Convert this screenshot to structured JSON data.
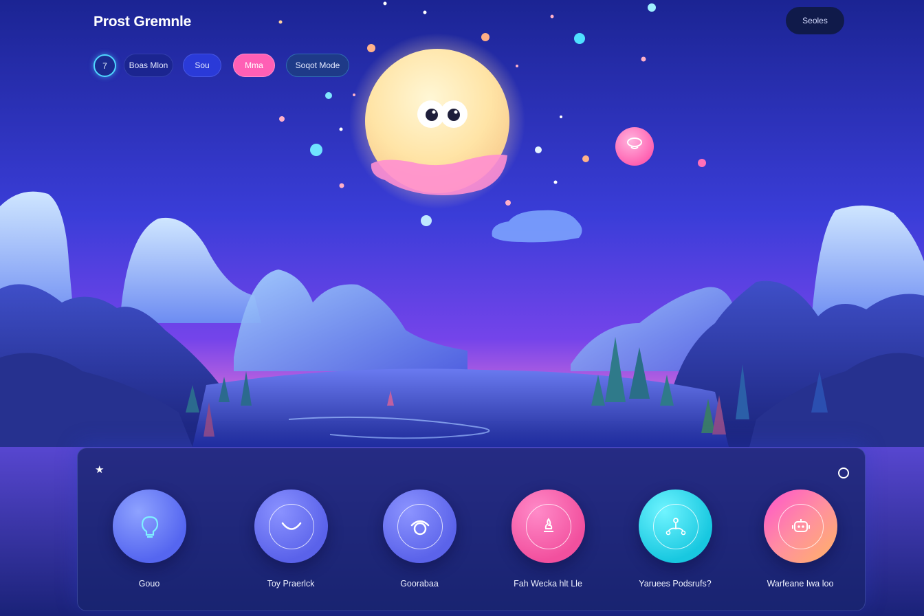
{
  "app": {
    "title": "Prost Gremnle",
    "top_button_label": "Seoles"
  },
  "nav": {
    "level": "7",
    "pills": [
      "Boas Mlon",
      "Sou",
      "Mma",
      "Soqot Mode"
    ]
  },
  "panel": {
    "items": [
      {
        "label": "Gouo",
        "icon": "lightbulb-icon",
        "color": "#5e6ff2"
      },
      {
        "label": "Toy Praerlck",
        "icon": "smile-icon",
        "color": "#6068ec"
      },
      {
        "label": "Goorabaa",
        "icon": "target-icon",
        "color": "#6068ec"
      },
      {
        "label": "Fah Wecka hlt Lle",
        "icon": "flame-icon",
        "color": "#f45aa6"
      },
      {
        "label": "Yaruees Podsrufs?",
        "icon": "network-icon",
        "color": "#22d0e4"
      },
      {
        "label": "Warfeane Iwa loo",
        "icon": "robot-icon",
        "color": "#ff7fa8"
      }
    ]
  },
  "scene": {
    "moon_color": "#ffe6a8",
    "sky_top": "#1c2496",
    "sky_mid": "#6a3ee8",
    "horizon": "#c46ad8"
  }
}
